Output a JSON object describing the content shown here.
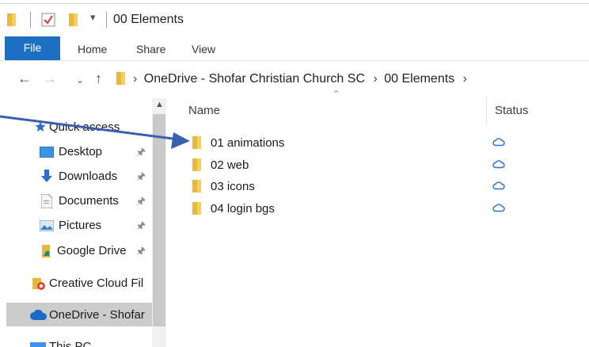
{
  "window": {
    "title": "00 Elements",
    "quick_access_toolbar": [
      "folder-icon",
      "properties-check-icon",
      "new-folder-icon",
      "customize-dropdown-icon"
    ]
  },
  "ribbon": {
    "tabs": [
      {
        "label": "File",
        "active": true
      },
      {
        "label": "Home"
      },
      {
        "label": "Share"
      },
      {
        "label": "View"
      }
    ],
    "accent_color": "#1d6fc2"
  },
  "address_bar": {
    "nav_buttons": [
      "back-arrow-icon",
      "forward-arrow-icon",
      "recent-dropdown-icon",
      "up-arrow-icon"
    ],
    "breadcrumbs": [
      "OneDrive - Shofar Christian Church SC",
      "00 Elements"
    ]
  },
  "sidebar": {
    "items": [
      {
        "label": "Quick access",
        "icon": "star-icon",
        "pinned": false
      },
      {
        "label": "Desktop",
        "icon": "desktop-icon",
        "pinned": true
      },
      {
        "label": "Downloads",
        "icon": "download-arrow-icon",
        "pinned": true
      },
      {
        "label": "Documents",
        "icon": "document-icon",
        "pinned": true
      },
      {
        "label": "Pictures",
        "icon": "pictures-icon",
        "pinned": true
      },
      {
        "label": "Google Drive",
        "icon": "google-drive-icon",
        "pinned": true
      },
      {
        "label": "Creative Cloud Fil",
        "icon": "creative-cloud-icon",
        "pinned": false
      },
      {
        "label": "OneDrive - Shofar",
        "icon": "onedrive-cloud-icon",
        "pinned": false,
        "selected": true
      },
      {
        "label": "This PC",
        "icon": "pc-icon",
        "pinned": false
      }
    ]
  },
  "file_list": {
    "columns": [
      {
        "label": "Name",
        "sorted": "ascending"
      },
      {
        "label": "Status"
      }
    ],
    "rows": [
      {
        "name": "01 animations",
        "status": "cloud-outline-icon"
      },
      {
        "name": "02 web",
        "status": "cloud-outline-icon"
      },
      {
        "name": "03 icons",
        "status": "cloud-outline-icon"
      },
      {
        "name": "04 login bgs",
        "status": "cloud-outline-icon"
      }
    ]
  },
  "annotation": {
    "type": "arrow",
    "color": "#3a5fae",
    "points_to": "01 animations"
  },
  "colors": {
    "folder_yellow": "#e8b83a",
    "cloud_blue": "#2a70c8",
    "selected_row": "#cccccc"
  }
}
